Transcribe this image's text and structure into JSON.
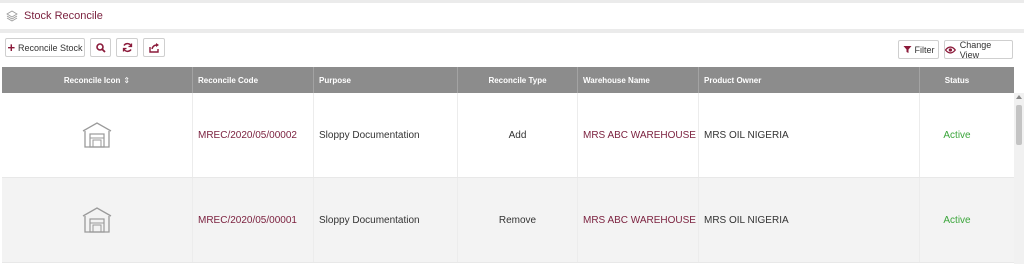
{
  "page": {
    "title": "Stock Reconcile"
  },
  "toolbar": {
    "reconcile_label": "Reconcile Stock",
    "filter_label": "Filter",
    "change_view_label": "Change View"
  },
  "table": {
    "headers": [
      "Reconcile Icon",
      "Reconcile Code",
      "Purpose",
      "Reconcile Type",
      "Warehouse Name",
      "Product Owner",
      "Status"
    ],
    "sort_indicator": "⇕",
    "rows": [
      {
        "code": "MREC/2020/05/00002",
        "purpose": "Sloppy Documentation",
        "type": "Add",
        "warehouse": "MRS ABC WAREHOUSE",
        "owner": "MRS OIL NIGERIA",
        "status": "Active"
      },
      {
        "code": "MREC/2020/05/00001",
        "purpose": "Sloppy Documentation",
        "type": "Remove",
        "warehouse": "MRS ABC WAREHOUSE",
        "owner": "MRS OIL NIGERIA",
        "status": "Active"
      }
    ]
  },
  "colors": {
    "accent": "#7a1f3d",
    "header_bg": "#8c8c8c",
    "active": "#3aa53a"
  },
  "icons": [
    "stack-icon",
    "plus-icon",
    "search-icon",
    "refresh-icon",
    "export-icon",
    "filter-icon",
    "eye-icon",
    "warehouse-icon"
  ]
}
